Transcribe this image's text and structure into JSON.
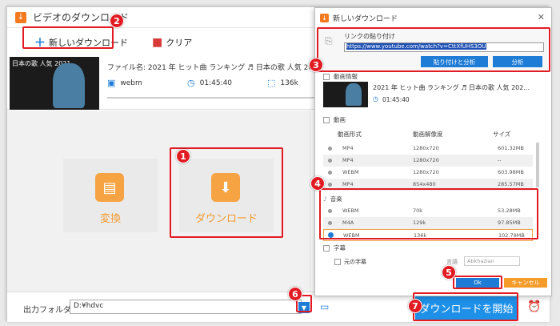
{
  "main_window": {
    "title": "ビデオのダウンロード",
    "toolbar": {
      "new_download_label": "新しいダウンロード",
      "clear_label": "クリア"
    },
    "item": {
      "filename": "ファイル名: 2021 年 ヒット曲 ランキング ♬ 日本の歌 人気 2021 日本の音楽 邦楽 10,0",
      "thumb_text": "日本の歌 人気 2021",
      "format": "webm",
      "duration": "01:45:40",
      "size": "136k"
    },
    "cards": {
      "convert_label": "変換",
      "download_label": "ダウンロード"
    },
    "bottom": {
      "output_folder_label": "出力フォルダ：",
      "output_folder_value": "D:¥hdvc",
      "start_label": "ダウンロードを開始"
    }
  },
  "dialog": {
    "title": "新しいダウンロード",
    "paste_link_label": "リンクの貼り付け",
    "url": "https://www.youtube.com/watch?v=CttXfUHS3OU",
    "paste_analyze_label": "貼り付けと分析",
    "analyze_label": "分析",
    "video_info_label": "動画情報",
    "video_title": "2021 年 ヒット曲 ランキング ♬ 日本の歌 人気 202...",
    "video_duration": "01:45:40",
    "video_section_label": "動画",
    "columns": [
      "動画形式",
      "動画解像度",
      "サイズ"
    ],
    "video_rows": [
      [
        "MP4",
        "1280x720",
        "601.32MB"
      ],
      [
        "MP4",
        "1280x720",
        "--"
      ],
      [
        "WEBM",
        "1280x720",
        "603.98MB"
      ],
      [
        "MP4",
        "854x480",
        "285.57MB"
      ]
    ],
    "audio_section_label": "音楽",
    "audio_rows": [
      [
        "WEBM",
        "70k",
        "53.28MB"
      ],
      [
        "M4A",
        "129k",
        "97.85MB"
      ],
      [
        "WEBM",
        "136k",
        "102.79MB"
      ]
    ],
    "subtitle_section_label": "字幕",
    "original_subtitle_label": "元の字幕",
    "language_label": "言語",
    "language_value": "Abkhazian",
    "ok_label": "Ok",
    "cancel_label": "キャンセル"
  },
  "badges": [
    "1",
    "2",
    "3",
    "4",
    "5",
    "6",
    "7"
  ],
  "colors": {
    "accent_blue": "#1e7bd6",
    "accent_orange": "#f39a2e",
    "annotation_red": "#e21b23"
  }
}
